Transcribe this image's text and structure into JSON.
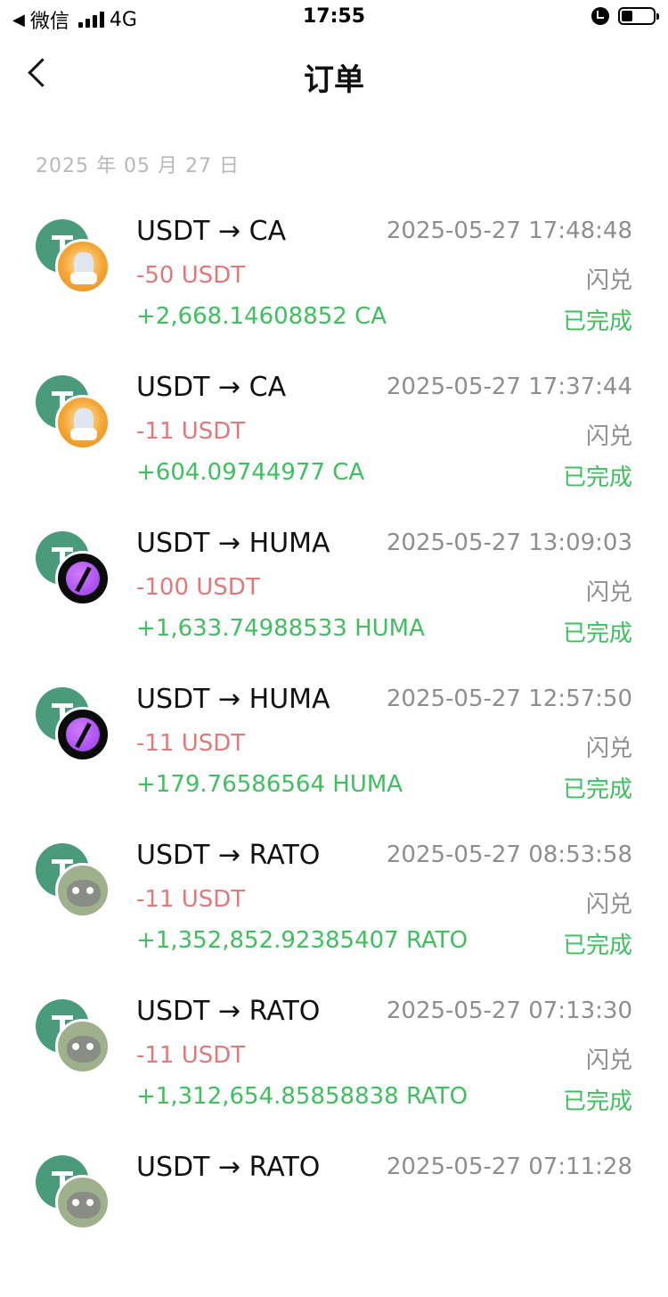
{
  "status_bar": {
    "back_app": "微信",
    "network": "4G",
    "time": "17:55",
    "icons": [
      "signal-icon",
      "alarm-icon",
      "battery-icon"
    ]
  },
  "nav": {
    "title": "订单",
    "back_icon": "chevron-left-icon"
  },
  "date_header": "2025 年 05 月 27 日",
  "colors": {
    "sent": "#e07a7a",
    "received": "#3fbf5e",
    "muted": "#8e8e8e",
    "usdt": "#4a9b7c"
  },
  "orders": [
    {
      "pair": "USDT → CA",
      "time": "2025-05-27 17:48:48",
      "sent": "-50 USDT",
      "type": "闪兑",
      "received": "+2,668.14608852 CA",
      "status": "已完成",
      "token_icon": "ca-token-icon"
    },
    {
      "pair": "USDT → CA",
      "time": "2025-05-27 17:37:44",
      "sent": "-11 USDT",
      "type": "闪兑",
      "received": "+604.09744977 CA",
      "status": "已完成",
      "token_icon": "ca-token-icon"
    },
    {
      "pair": "USDT → HUMA",
      "time": "2025-05-27 13:09:03",
      "sent": "-100 USDT",
      "type": "闪兑",
      "received": "+1,633.74988533 HUMA",
      "status": "已完成",
      "token_icon": "huma-token-icon"
    },
    {
      "pair": "USDT → HUMA",
      "time": "2025-05-27 12:57:50",
      "sent": "-11 USDT",
      "type": "闪兑",
      "received": "+179.76586564 HUMA",
      "status": "已完成",
      "token_icon": "huma-token-icon"
    },
    {
      "pair": "USDT → RATO",
      "time": "2025-05-27 08:53:58",
      "sent": "-11 USDT",
      "type": "闪兑",
      "received": "+1,352,852.92385407 RATO",
      "status": "已完成",
      "token_icon": "rato-token-icon"
    },
    {
      "pair": "USDT → RATO",
      "time": "2025-05-27 07:13:30",
      "sent": "-11 USDT",
      "type": "闪兑",
      "received": "+1,312,654.85858838 RATO",
      "status": "已完成",
      "token_icon": "rato-token-icon"
    },
    {
      "pair": "USDT → RATO",
      "time": "2025-05-27 07:11:28",
      "token_icon": "rato-token-icon"
    }
  ]
}
